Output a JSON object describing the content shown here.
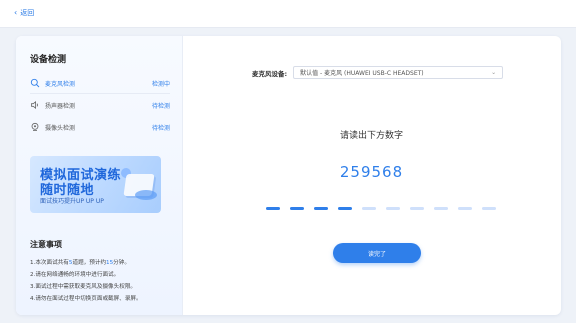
{
  "topbar": {
    "back_label": "返回"
  },
  "left": {
    "title": "设备检测",
    "checks": [
      {
        "name": "麦克风检测",
        "status": "检测中"
      },
      {
        "name": "扬声器检测",
        "status": "待检测"
      },
      {
        "name": "摄像头检测",
        "status": "待检测"
      }
    ],
    "banner": {
      "title_line1": "模拟面试演练",
      "title_line2": "随时随地",
      "subtitle": "面试技巧提升UP UP UP"
    },
    "notes": {
      "title": "注意事项",
      "line1_a": "1.本次面试共有",
      "line1_b": "5",
      "line1_c": "道题，预计约",
      "line1_d": "15",
      "line1_e": "分钟。",
      "line2": "2.请在网络通畅的环境中进行面试。",
      "line3": "3.面试过程中需获取麦克风及摄像头权限。",
      "line4": "4.请勿在面试过程中切换页面或截屏、录屏。"
    }
  },
  "right": {
    "mic_label": "麦克风设备:",
    "mic_value": "默认值 - 麦克风 (HUAWEI USB-C HEADSET)",
    "prompt": "请读出下方数字",
    "digits": "259568",
    "progress": {
      "filled": 4,
      "total": 10
    },
    "done_label": "读完了"
  },
  "colors": {
    "accent": "#2f7fea",
    "inactive_dot": "#cfe0fb"
  }
}
